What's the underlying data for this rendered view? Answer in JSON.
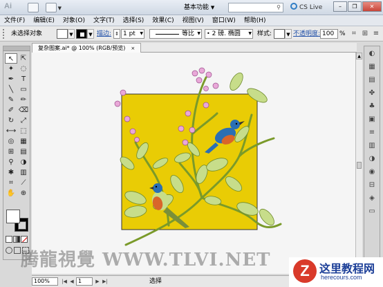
{
  "app": {
    "logo": "Ai",
    "workspace": "基本功能",
    "cs_live": "CS Live"
  },
  "menus": [
    "文件(F)",
    "编辑(E)",
    "对象(O)",
    "文字(T)",
    "选择(S)",
    "效果(C)",
    "视图(V)",
    "窗口(W)",
    "帮助(H)"
  ],
  "control": {
    "selection_state": "未选择对象",
    "stroke_label": "描边:",
    "stroke_weight": "1 pt",
    "stroke_profile": "等比",
    "brush_def": "2 磅. 椭圆",
    "style_label": "样式:",
    "opacity_label": "不透明度:",
    "opacity_value": "100",
    "opacity_unit": "%"
  },
  "document": {
    "tab_label": "复杂图案.ai* @ 100% (RGB/预览)",
    "close": "×"
  },
  "status": {
    "zoom": "100%",
    "page": "1",
    "tool_text": "选择"
  },
  "watermark": {
    "text": "腾龍視覺 WWW.TLVI.NET",
    "brand_letter": "Z",
    "brand_name": "这里教程网",
    "brand_url": "herecours.com"
  },
  "colors": {
    "artboard_yellow": "#e9cc05",
    "bird_blue": "#2a6fb4",
    "bird_orange": "#d9652a",
    "stem_green": "#7a9a2a",
    "leaf_green": "#c7dd8a",
    "flower_pink": "#e9a8d8"
  }
}
